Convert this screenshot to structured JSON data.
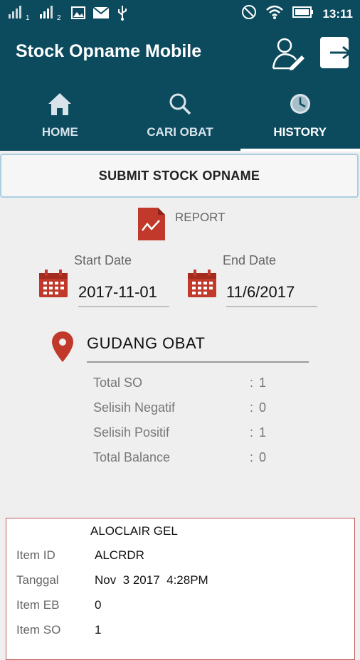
{
  "statusbar": {
    "time": "13:11",
    "sim1_badge": "1",
    "sim2_badge": "2"
  },
  "appbar": {
    "title": "Stock Opname Mobile"
  },
  "tabs": [
    {
      "label": "HOME",
      "icon": "home-icon"
    },
    {
      "label": "CARI OBAT",
      "icon": "search-icon"
    },
    {
      "label": "HISTORY",
      "icon": "history-icon",
      "active": true
    }
  ],
  "submit": {
    "label": "SUBMIT STOCK OPNAME"
  },
  "report": {
    "label": "REPORT"
  },
  "dates": {
    "start_label": "Start Date",
    "start_value": "2017-11-01",
    "end_label": "End Date",
    "end_value": "11/6/2017"
  },
  "location": {
    "name": "GUDANG OBAT"
  },
  "stats": [
    {
      "key": "Total SO",
      "value": "1"
    },
    {
      "key": "Selisih Negatif",
      "value": "0"
    },
    {
      "key": "Selisih Positif",
      "value": "1"
    },
    {
      "key": "Total Balance",
      "value": "0"
    }
  ],
  "stat_separator": ":",
  "item": {
    "title": "ALOCLAIR GEL",
    "rows": [
      {
        "key": "Item ID",
        "value": "ALCRDR"
      },
      {
        "key": "Tanggal",
        "value": "Nov  3 2017  4:28PM"
      },
      {
        "key": "Item EB",
        "value": "0"
      },
      {
        "key": "Item SO",
        "value": "1"
      }
    ]
  },
  "colors": {
    "primary": "#0c4a5e",
    "accent_red": "#c0392b"
  }
}
